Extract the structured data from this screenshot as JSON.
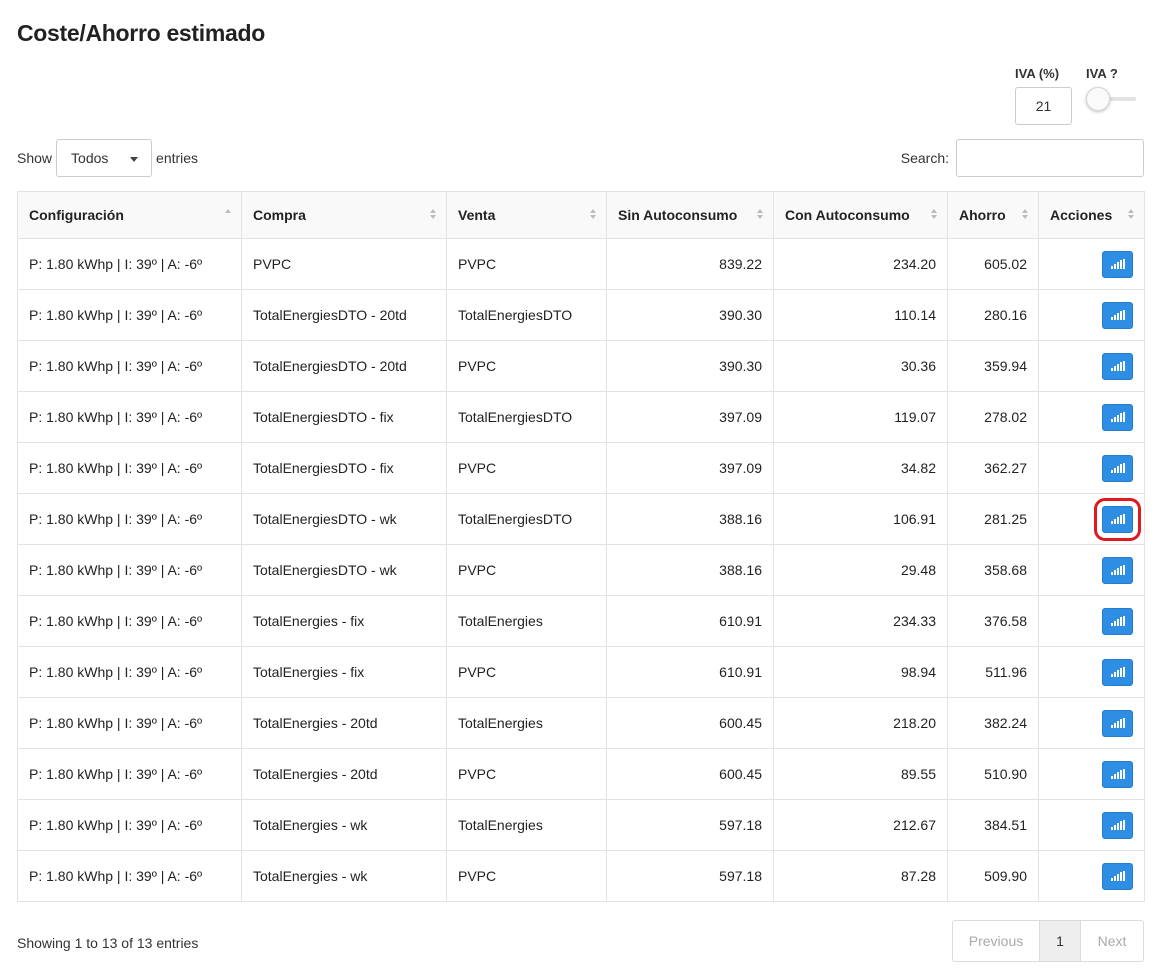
{
  "title": "Coste/Ahorro estimado",
  "iva": {
    "pct_label": "IVA (%)",
    "pct_value": "21",
    "toggle_label": "IVA ?",
    "toggle_on": false
  },
  "length": {
    "show_label": "Show",
    "selected": "Todos",
    "entries_label": "entries"
  },
  "search": {
    "label": "Search:",
    "value": ""
  },
  "table": {
    "headers": [
      "Configuración",
      "Compra",
      "Venta",
      "Sin Autoconsumo",
      "Con Autoconsumo",
      "Ahorro",
      "Acciones"
    ],
    "action_icon": "bar-chart-icon",
    "rows": [
      [
        "P: 1.80 kWhp | I: 39º | A: -6º",
        "PVPC",
        "PVPC",
        "839.22",
        "234.20",
        "605.02"
      ],
      [
        "P: 1.80 kWhp | I: 39º | A: -6º",
        "TotalEnergiesDTO - 20td",
        "TotalEnergiesDTO",
        "390.30",
        "110.14",
        "280.16"
      ],
      [
        "P: 1.80 kWhp | I: 39º | A: -6º",
        "TotalEnergiesDTO - 20td",
        "PVPC",
        "390.30",
        "30.36",
        "359.94"
      ],
      [
        "P: 1.80 kWhp | I: 39º | A: -6º",
        "TotalEnergiesDTO - fix",
        "TotalEnergiesDTO",
        "397.09",
        "119.07",
        "278.02"
      ],
      [
        "P: 1.80 kWhp | I: 39º | A: -6º",
        "TotalEnergiesDTO - fix",
        "PVPC",
        "397.09",
        "34.82",
        "362.27"
      ],
      [
        "P: 1.80 kWhp | I: 39º | A: -6º",
        "TotalEnergiesDTO - wk",
        "TotalEnergiesDTO",
        "388.16",
        "106.91",
        "281.25"
      ],
      [
        "P: 1.80 kWhp | I: 39º | A: -6º",
        "TotalEnergiesDTO - wk",
        "PVPC",
        "388.16",
        "29.48",
        "358.68"
      ],
      [
        "P: 1.80 kWhp | I: 39º | A: -6º",
        "TotalEnergies - fix",
        "TotalEnergies",
        "610.91",
        "234.33",
        "376.58"
      ],
      [
        "P: 1.80 kWhp | I: 39º | A: -6º",
        "TotalEnergies - fix",
        "PVPC",
        "610.91",
        "98.94",
        "511.96"
      ],
      [
        "P: 1.80 kWhp | I: 39º | A: -6º",
        "TotalEnergies - 20td",
        "TotalEnergies",
        "600.45",
        "218.20",
        "382.24"
      ],
      [
        "P: 1.80 kWhp | I: 39º | A: -6º",
        "TotalEnergies - 20td",
        "PVPC",
        "600.45",
        "89.55",
        "510.90"
      ],
      [
        "P: 1.80 kWhp | I: 39º | A: -6º",
        "TotalEnergies - wk",
        "TotalEnergies",
        "597.18",
        "212.67",
        "384.51"
      ],
      [
        "P: 1.80 kWhp | I: 39º | A: -6º",
        "TotalEnergies - wk",
        "PVPC",
        "597.18",
        "87.28",
        "509.90"
      ]
    ],
    "highlighted_row": 5
  },
  "footer": {
    "info": "Showing 1 to 13 of 13 entries",
    "previous": "Previous",
    "page": "1",
    "next": "Next"
  },
  "colors": {
    "action_button": "#2d8ee3",
    "highlight": "#e0181f"
  }
}
